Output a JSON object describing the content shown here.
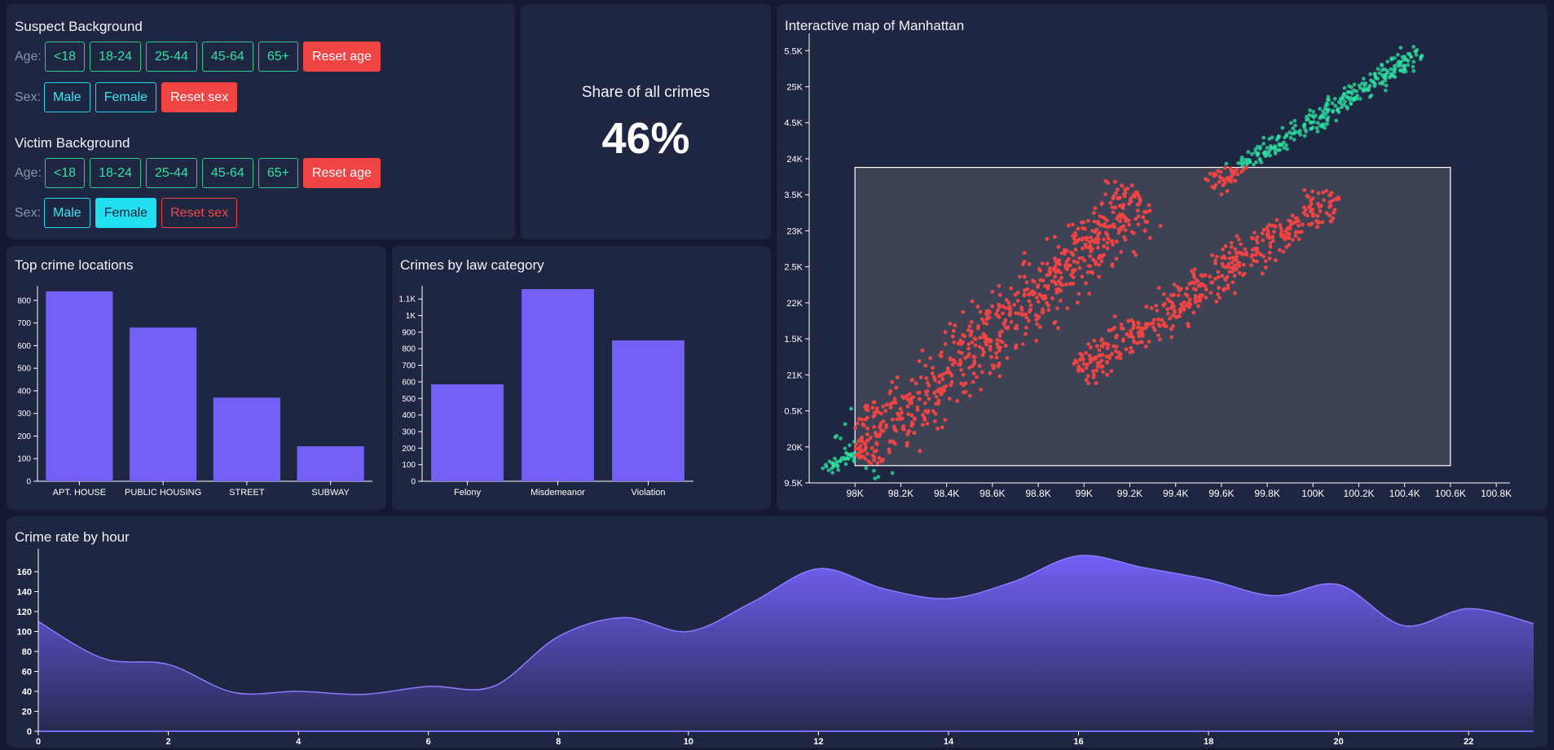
{
  "filters": {
    "suspect": {
      "title": "Suspect Background",
      "age_label": "Age:",
      "ages": [
        "<18",
        "18-24",
        "25-44",
        "45-64",
        "65+"
      ],
      "reset_age": "Reset age",
      "sex_label": "Sex:",
      "sexes": [
        "Male",
        "Female"
      ],
      "reset_sex": "Reset sex"
    },
    "victim": {
      "title": "Victim Background",
      "age_label": "Age:",
      "ages": [
        "<18",
        "18-24",
        "25-44",
        "45-64",
        "65+"
      ],
      "reset_age": "Reset age",
      "sex_label": "Sex:",
      "sexes": [
        "Male",
        "Female"
      ],
      "selected_sex": "Female",
      "reset_sex": "Reset sex"
    }
  },
  "share": {
    "label": "Share of all crimes",
    "value": "46%"
  },
  "colors": {
    "bar": "#7360f6",
    "accent_red": "#ef4444",
    "accent_green": "#2ee3a1",
    "accent_cyan": "#22e0f0"
  },
  "chart_data": [
    {
      "id": "locations",
      "type": "bar",
      "title": "Top crime locations",
      "categories": [
        "APT. HOUSE",
        "PUBLIC HOUSING",
        "STREET",
        "SUBWAY"
      ],
      "values": [
        840,
        680,
        370,
        155
      ],
      "ylim": [
        0,
        850
      ],
      "yticks": [
        0,
        100,
        200,
        300,
        400,
        500,
        600,
        700,
        800
      ],
      "ytick_labels": [
        "0",
        "100",
        "200",
        "300",
        "400",
        "500",
        "600",
        "700",
        "800"
      ]
    },
    {
      "id": "law",
      "type": "bar",
      "title": "Crimes by law category",
      "categories": [
        "Felony",
        "Misdemeanor",
        "Violation"
      ],
      "values": [
        585,
        1160,
        850
      ],
      "ylim": [
        0,
        1160
      ],
      "yticks": [
        0,
        100,
        200,
        300,
        400,
        500,
        600,
        700,
        800,
        900,
        1000,
        1100
      ],
      "ytick_labels": [
        "0",
        "100",
        "200",
        "300",
        "400",
        "500",
        "600",
        "700",
        "800",
        "900",
        "1K",
        "1.1K"
      ]
    },
    {
      "id": "map",
      "type": "scatter",
      "title": "Interactive map of Manhattan",
      "xlim": [
        97800,
        100860
      ],
      "ylim": [
        195000,
        256500
      ],
      "xticks": [
        98000,
        98200,
        98400,
        98600,
        98800,
        99000,
        99200,
        99400,
        99600,
        99800,
        100000,
        100200,
        100400,
        100600,
        100800
      ],
      "xtick_labels": [
        "98K",
        "98.2K",
        "98.4K",
        "98.6K",
        "98.8K",
        "99K",
        "99.2K",
        "99.4K",
        "99.6K",
        "99.8K",
        "100K",
        "100.2K",
        "100.4K",
        "100.6K",
        "100.8K"
      ],
      "yticks": [
        195000,
        200000,
        205000,
        210000,
        215000,
        220000,
        225000,
        230000,
        235000,
        240000,
        245000,
        250000,
        255000
      ],
      "ytick_labels": [
        "9.5K",
        "20K",
        "0.5K",
        "21K",
        "1.5K",
        "22K",
        "2.5K",
        "23K",
        "3.5K",
        "24K",
        "4.5K",
        "25K",
        "5.5K"
      ],
      "selection": {
        "x": [
          98000,
          100600
        ],
        "y": [
          197400,
          238800
        ]
      },
      "selected_color": "#ef4444",
      "unselected_color": "#2ee3a1"
    },
    {
      "id": "hourly",
      "type": "area",
      "title": "Crime rate by hour",
      "x": [
        0,
        1,
        2,
        3,
        4,
        5,
        6,
        7,
        8,
        9,
        10,
        11,
        12,
        13,
        14,
        15,
        16,
        17,
        18,
        19,
        20,
        21,
        22,
        23
      ],
      "values": [
        110,
        73,
        67,
        39,
        40,
        37,
        45,
        45,
        95,
        114,
        100,
        130,
        163,
        143,
        133,
        150,
        176,
        164,
        152,
        136,
        147,
        106,
        123,
        108
      ],
      "xlim": [
        0,
        23
      ],
      "ylim": [
        0,
        178
      ],
      "xticks": [
        0,
        2,
        4,
        6,
        8,
        10,
        12,
        14,
        16,
        18,
        20,
        22
      ],
      "yticks": [
        0,
        20,
        40,
        60,
        80,
        100,
        120,
        140,
        160
      ],
      "ytick_labels": [
        "0",
        "20",
        "40",
        "60",
        "80",
        "100",
        "120",
        "140",
        "160"
      ]
    }
  ]
}
